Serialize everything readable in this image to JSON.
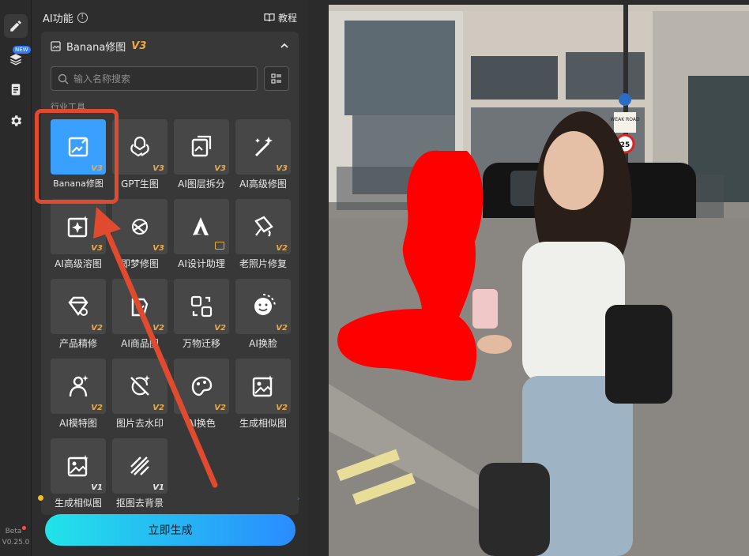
{
  "panel": {
    "title": "AI功能",
    "tutorial_label": "教程"
  },
  "section": {
    "title": "Banana修图",
    "version": "V3",
    "search_placeholder": "输入名称搜索",
    "category_label": "行业工具"
  },
  "tools": [
    {
      "label": "Banana修图",
      "version": "V3",
      "icon": "image-edit-icon",
      "selected": true
    },
    {
      "label": "GPT生图",
      "version": "V3",
      "icon": "gpt-knot-icon",
      "selected": false
    },
    {
      "label": "AI图层拆分",
      "version": "V3",
      "icon": "layer-split-icon",
      "selected": false
    },
    {
      "label": "AI高级修图",
      "version": "V3",
      "icon": "magic-wand-icon",
      "selected": false
    },
    {
      "label": "AI高级溶图",
      "version": "V3",
      "icon": "sparkle-frame-icon",
      "selected": false
    },
    {
      "label": "即梦修图",
      "version": "V3",
      "icon": "dream-icon",
      "selected": false
    },
    {
      "label": "AI设计助理",
      "version": "",
      "icon": "design-a-icon",
      "selected": false,
      "crown": true
    },
    {
      "label": "老照片修复",
      "version": "V2",
      "icon": "old-photo-icon",
      "selected": false
    },
    {
      "label": "产品精修",
      "version": "V2",
      "icon": "diamond-icon",
      "selected": false
    },
    {
      "label": "AI商品图",
      "version": "V2",
      "icon": "product-icon",
      "selected": false
    },
    {
      "label": "万物迁移",
      "version": "V2",
      "icon": "transfer-icon",
      "selected": false
    },
    {
      "label": "AI换脸",
      "version": "V2",
      "icon": "face-swap-icon",
      "selected": false
    },
    {
      "label": "AI模特图",
      "version": "V2",
      "icon": "model-icon",
      "selected": false
    },
    {
      "label": "图片去水印",
      "version": "V2",
      "icon": "watermark-remove-icon",
      "selected": false
    },
    {
      "label": "AI换色",
      "version": "V2",
      "icon": "recolor-icon",
      "selected": false
    },
    {
      "label": "生成相似图",
      "version": "V2",
      "icon": "similar-image-icon",
      "selected": false
    },
    {
      "label": "生成相似图",
      "version": "V1",
      "icon": "similar-image-icon",
      "selected": false
    },
    {
      "label": "抠图去背景",
      "version": "V1",
      "icon": "remove-bg-icon",
      "selected": false
    }
  ],
  "generate_label": "立即生成",
  "version": {
    "beta": "Beta",
    "number": "V0.25.0"
  },
  "rail": {
    "new_badge": "NEW"
  },
  "street_signs": {
    "weak_road": "WEAK ROAD",
    "speed": "25"
  },
  "colors": {
    "accent": "#3aa0ff",
    "version_badge": "#f0a93b",
    "annotation": "#e04a2f",
    "mask": "#ff0000"
  }
}
